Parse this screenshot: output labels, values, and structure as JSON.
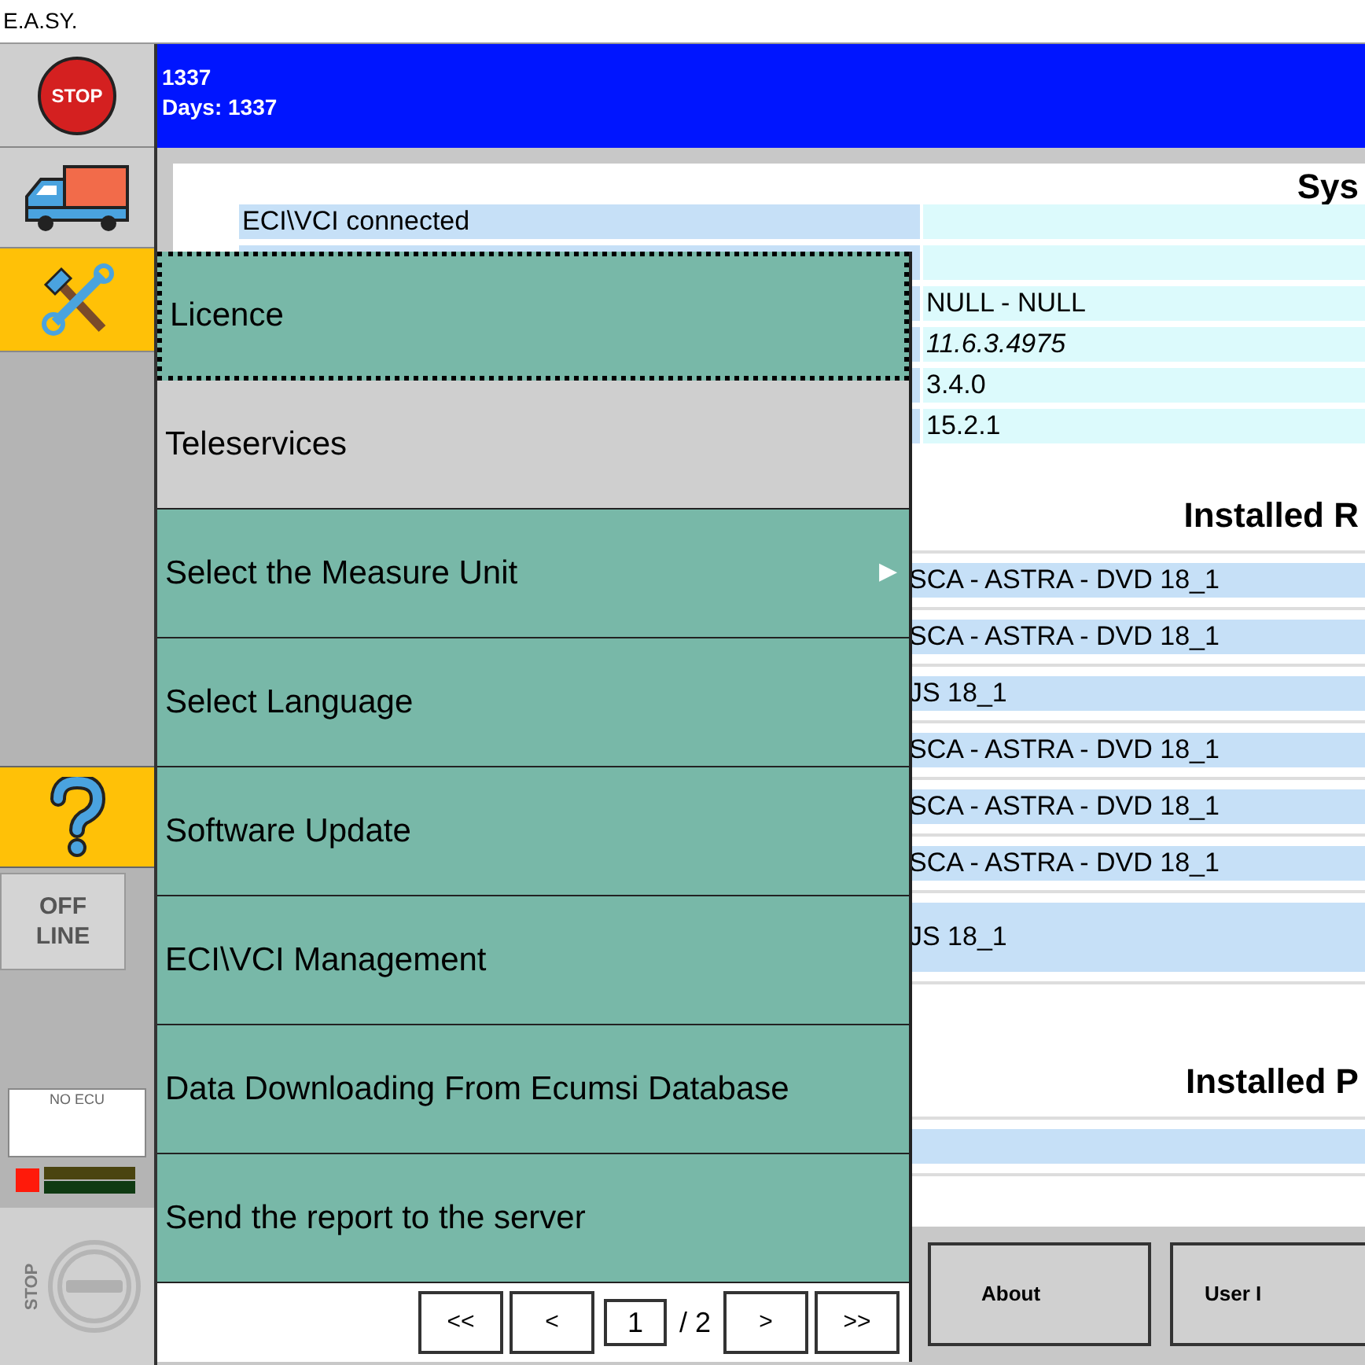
{
  "window": {
    "title": "E.A.SY."
  },
  "header": {
    "lines": [
      "1337",
      "Days: 1337"
    ]
  },
  "sidebar": {
    "stop_label": "STOP",
    "dial_label": "STOP",
    "offline_button": {
      "lines": [
        "OFF",
        "LINE"
      ]
    },
    "ecu_panel": {
      "label": "NO ECU"
    }
  },
  "system_section": {
    "title": "Sys",
    "rows": [
      {
        "label": "ECI\\VCI connected",
        "value": ""
      },
      {
        "label": "",
        "value": ""
      },
      {
        "label": "",
        "value": "NULL - NULL"
      },
      {
        "label": "",
        "value": "11.6.3.4975",
        "italic": true
      },
      {
        "label": "",
        "value": "3.4.0"
      },
      {
        "label": "",
        "value": "15.2.1"
      }
    ]
  },
  "releases_section": {
    "title": "Installed R",
    "rows": [
      "SCA - ASTRA - DVD 18_1",
      "SCA - ASTRA - DVD 18_1",
      "JS 18_1",
      "SCA - ASTRA - DVD 18_1",
      "SCA - ASTRA - DVD 18_1",
      "SCA - ASTRA - DVD 18_1",
      "JS 18_1"
    ]
  },
  "packages_section": {
    "title": "Installed P"
  },
  "bottom_buttons": [
    "About",
    "User I"
  ],
  "menu": {
    "items": [
      {
        "label": "Licence",
        "selected": false,
        "focused": true
      },
      {
        "label": "Teleservices",
        "selected": true,
        "focused": false
      },
      {
        "label": "Select the Measure Unit",
        "selected": false,
        "focused": false,
        "submenu_arrow": "▶"
      },
      {
        "label": "Select Language",
        "selected": false,
        "focused": false
      },
      {
        "label": "Software Update",
        "selected": false,
        "focused": false
      },
      {
        "label": "ECI\\VCI Management",
        "selected": false,
        "focused": false
      },
      {
        "label": "Data Downloading From Ecumsi Database",
        "selected": false,
        "focused": false
      },
      {
        "label": "Send the report to the server",
        "selected": false,
        "focused": false
      }
    ],
    "pager": {
      "first": "<<",
      "prev": "<",
      "page": "1",
      "total": "/ 2",
      "next": ">",
      "last": ">>"
    }
  }
}
